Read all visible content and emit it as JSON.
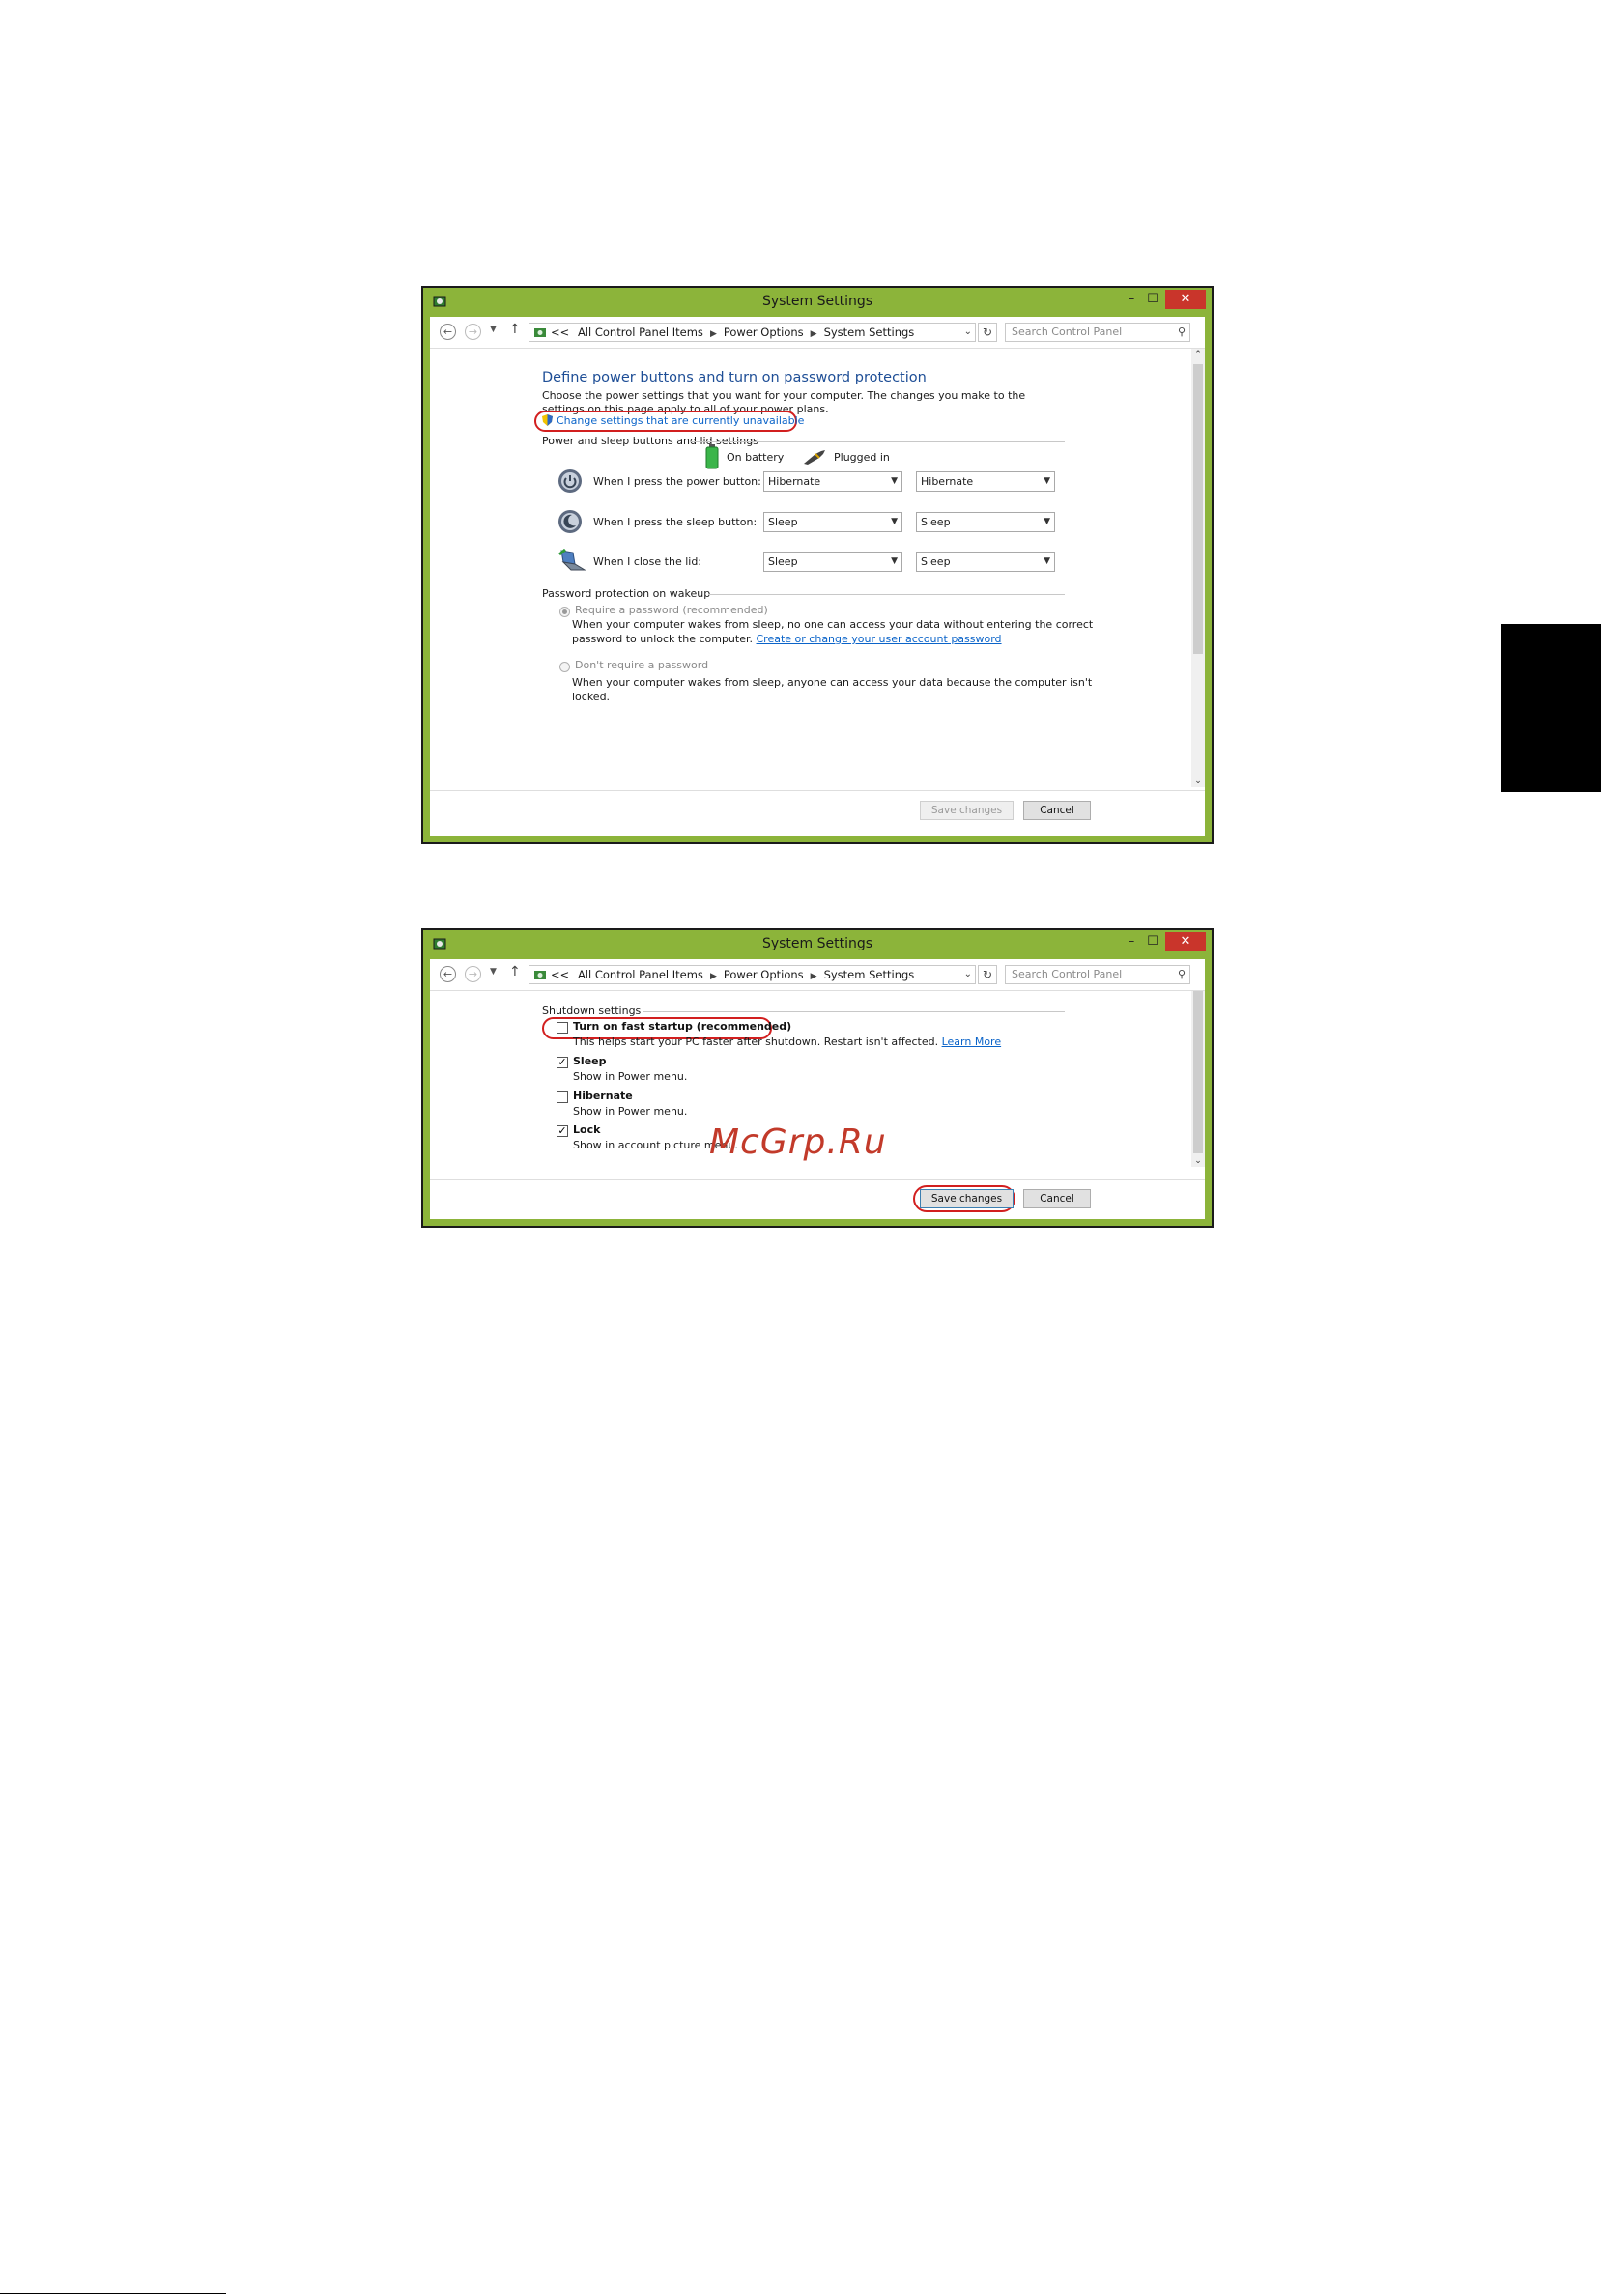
{
  "window1": {
    "title": "System Settings",
    "breadcrumb": [
      "All Control Panel Items",
      "Power Options",
      "System Settings"
    ],
    "breadcrumb_prefix": "<<",
    "search_placeholder": "Search Control Panel",
    "heading": "Define power buttons and turn on password protection",
    "intro": "Choose the power settings that you want for your computer. The changes you make to the settings on this page apply to all of your power plans.",
    "change_settings_link": "Change settings that are currently unavailable",
    "power_section": "Power and sleep buttons and lid settings",
    "col_battery": "On battery",
    "col_plugged": "Plugged in",
    "rows": [
      {
        "label": "When I press the power button:",
        "battery": "Hibernate",
        "plugged": "Hibernate"
      },
      {
        "label": "When I press the sleep button:",
        "battery": "Sleep",
        "plugged": "Sleep"
      },
      {
        "label": "When I close the lid:",
        "battery": "Sleep",
        "plugged": "Sleep"
      }
    ],
    "password_section": "Password protection on wakeup",
    "require_password": {
      "label": "Require a password (recommended)",
      "desc_1": "When your computer wakes from sleep, no one can access your data without entering the correct",
      "desc_2": "password to unlock the computer.",
      "link": "Create or change your user account password",
      "selected": true
    },
    "no_password": {
      "label": "Don't require a password",
      "desc_1": "When your computer wakes from sleep, anyone can access your data because the computer isn't",
      "desc_2": "locked.",
      "selected": false
    },
    "save_label": "Save changes",
    "cancel_label": "Cancel"
  },
  "window2": {
    "title": "System Settings",
    "breadcrumb": [
      "All Control Panel Items",
      "Power Options",
      "System Settings"
    ],
    "breadcrumb_prefix": "<<",
    "search_placeholder": "Search Control Panel",
    "shutdown_section": "Shutdown settings",
    "options": [
      {
        "label": "Turn on fast startup (recommended)",
        "desc": "This helps start your PC faster after shutdown. Restart isn't affected.",
        "link": "Learn More",
        "checked": false
      },
      {
        "label": "Sleep",
        "desc": "Show in Power menu.",
        "checked": true
      },
      {
        "label": "Hibernate",
        "desc": "Show in Power menu.",
        "checked": false
      },
      {
        "label": "Lock",
        "desc": "Show in account picture menu.",
        "checked": true
      }
    ],
    "save_label": "Save changes",
    "cancel_label": "Cancel"
  },
  "watermark": "McGrp.Ru",
  "colors": {
    "frame": "#8cb43a",
    "close_button": "#c9352b",
    "heading": "#1e4e96",
    "link": "#0b64c9",
    "highlight": "#d21f1f",
    "side_tab": "#000000"
  },
  "icons": [
    "app-icon",
    "back-icon",
    "forward-icon",
    "up-icon",
    "refresh-icon",
    "search-icon",
    "uac-shield-icon",
    "battery-icon",
    "plug-icon",
    "power-button-icon",
    "sleep-button-icon",
    "laptop-lid-icon"
  ]
}
